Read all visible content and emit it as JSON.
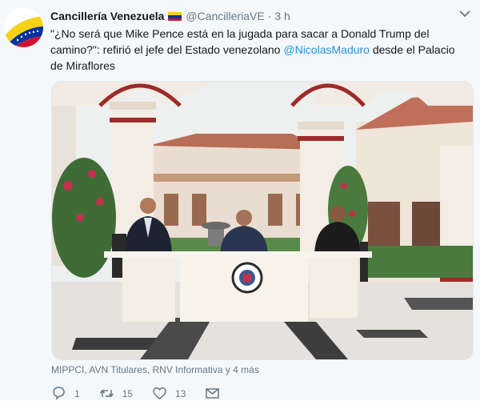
{
  "tweet": {
    "author_name": "Cancillería Venezuela",
    "flag_icon": "venezuela-flag-icon",
    "handle": "@CancilleriaVE",
    "separator": "·",
    "time": "3 h",
    "text_part1": "\"¿No será que Mike Pence está en la jugada para sacar a Donald Trump del camino?\": refirió el jefe del Estado venezolano ",
    "mention": "@NicolasMaduro",
    "text_part2": " desde el Palacio de Miraflores",
    "tagged": "MIPPCI, AVN Titulares, RNV Informativa y 4 más",
    "replies": "1",
    "retweets": "15",
    "likes": "13"
  },
  "colors": {
    "accent": "#1b95e0",
    "muted": "#657786",
    "flag_yellow": "#f7d117",
    "flag_blue": "#0033a0",
    "flag_red": "#cf142b"
  }
}
